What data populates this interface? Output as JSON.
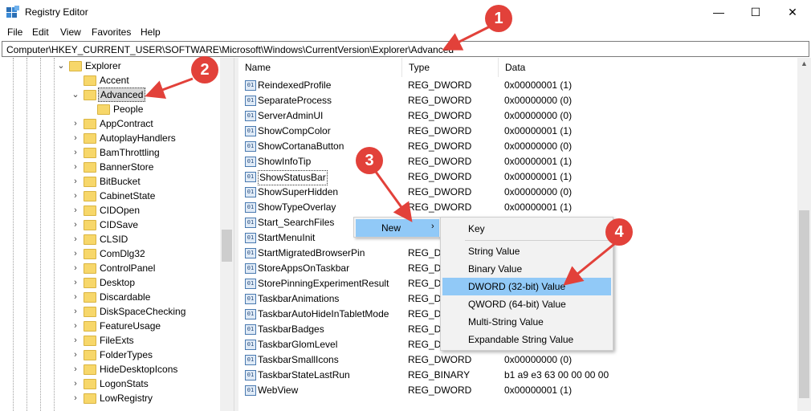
{
  "window": {
    "title": "Registry Editor",
    "minimize_glyph": "—",
    "maximize_glyph": "☐",
    "close_glyph": "✕"
  },
  "menubar": {
    "items": [
      "File",
      "Edit",
      "View",
      "Favorites",
      "Help"
    ]
  },
  "address": {
    "path": "Computer\\HKEY_CURRENT_USER\\SOFTWARE\\Microsoft\\Windows\\CurrentVersion\\Explorer\\Advanced"
  },
  "tree": {
    "items": [
      {
        "label": "Explorer",
        "expanded": true,
        "selected": false
      },
      {
        "label": "Accent",
        "expanded": false,
        "selected": false
      },
      {
        "label": "Advanced",
        "expanded": true,
        "selected": true
      },
      {
        "label": "People",
        "expanded": false,
        "selected": false
      },
      {
        "label": "AppContract",
        "expanded": false,
        "selected": false
      },
      {
        "label": "AutoplayHandlers",
        "expanded": false,
        "selected": false
      },
      {
        "label": "BamThrottling",
        "expanded": false,
        "selected": false
      },
      {
        "label": "BannerStore",
        "expanded": false,
        "selected": false
      },
      {
        "label": "BitBucket",
        "expanded": false,
        "selected": false
      },
      {
        "label": "CabinetState",
        "expanded": false,
        "selected": false
      },
      {
        "label": "CIDOpen",
        "expanded": false,
        "selected": false
      },
      {
        "label": "CIDSave",
        "expanded": false,
        "selected": false
      },
      {
        "label": "CLSID",
        "expanded": false,
        "selected": false
      },
      {
        "label": "ComDlg32",
        "expanded": false,
        "selected": false
      },
      {
        "label": "ControlPanel",
        "expanded": false,
        "selected": false
      },
      {
        "label": "Desktop",
        "expanded": false,
        "selected": false
      },
      {
        "label": "Discardable",
        "expanded": false,
        "selected": false
      },
      {
        "label": "DiskSpaceChecking",
        "expanded": false,
        "selected": false
      },
      {
        "label": "FeatureUsage",
        "expanded": false,
        "selected": false
      },
      {
        "label": "FileExts",
        "expanded": false,
        "selected": false
      },
      {
        "label": "FolderTypes",
        "expanded": false,
        "selected": false
      },
      {
        "label": "HideDesktopIcons",
        "expanded": false,
        "selected": false
      },
      {
        "label": "LogonStats",
        "expanded": false,
        "selected": false
      },
      {
        "label": "LowRegistry",
        "expanded": false,
        "selected": false
      }
    ]
  },
  "list": {
    "columns": {
      "name": "Name",
      "type": "Type",
      "data": "Data"
    },
    "rows": [
      {
        "name": "ReindexedProfile",
        "type": "REG_DWORD",
        "data": "0x00000001 (1)",
        "icon": "dword"
      },
      {
        "name": "SeparateProcess",
        "type": "REG_DWORD",
        "data": "0x00000000 (0)",
        "icon": "dword"
      },
      {
        "name": "ServerAdminUI",
        "type": "REG_DWORD",
        "data": "0x00000000 (0)",
        "icon": "dword"
      },
      {
        "name": "ShowCompColor",
        "type": "REG_DWORD",
        "data": "0x00000001 (1)",
        "icon": "dword"
      },
      {
        "name": "ShowCortanaButton",
        "type": "REG_DWORD",
        "data": "0x00000000 (0)",
        "icon": "dword"
      },
      {
        "name": "ShowInfoTip",
        "type": "REG_DWORD",
        "data": "0x00000001 (1)",
        "icon": "dword"
      },
      {
        "name": "ShowStatusBar",
        "type": "REG_DWORD",
        "data": "0x00000001 (1)",
        "icon": "dword",
        "focused": true
      },
      {
        "name": "ShowSuperHidden",
        "type": "REG_DWORD",
        "data": "0x00000000 (0)",
        "icon": "dword"
      },
      {
        "name": "ShowTypeOverlay",
        "type": "REG_DWORD",
        "data": "0x00000001 (1)",
        "icon": "dword"
      },
      {
        "name": "Start_SearchFiles",
        "type": "",
        "data": "",
        "icon": "dword"
      },
      {
        "name": "StartMenuInit",
        "type": "",
        "data": "",
        "icon": "dword"
      },
      {
        "name": "StartMigratedBrowserPin",
        "type": "REG_DW",
        "data": "",
        "icon": "dword"
      },
      {
        "name": "StoreAppsOnTaskbar",
        "type": "REG_DW",
        "data": "",
        "icon": "dword"
      },
      {
        "name": "StorePinningExperimentResult",
        "type": "REG_DW",
        "data": "",
        "icon": "dword"
      },
      {
        "name": "TaskbarAnimations",
        "type": "REG_DW",
        "data": "",
        "icon": "dword"
      },
      {
        "name": "TaskbarAutoHideInTabletMode",
        "type": "REG_DW",
        "data": "",
        "icon": "dword"
      },
      {
        "name": "TaskbarBadges",
        "type": "REG_DW",
        "data": "",
        "icon": "dword"
      },
      {
        "name": "TaskbarGlomLevel",
        "type": "REG_DW",
        "data": "",
        "icon": "dword"
      },
      {
        "name": "TaskbarSmallIcons",
        "type": "REG_DWORD",
        "data": "0x00000000 (0)",
        "icon": "dword"
      },
      {
        "name": "TaskbarStateLastRun",
        "type": "REG_BINARY",
        "data": "b1 a9 e3 63 00 00 00 00",
        "icon": "binary"
      },
      {
        "name": "WebView",
        "type": "REG_DWORD",
        "data": "0x00000001 (1)",
        "icon": "dword"
      }
    ]
  },
  "context_menu": {
    "new_label": "New",
    "new_arrow": "›"
  },
  "submenu": {
    "items": [
      "Key",
      "String Value",
      "Binary Value",
      "DWORD (32-bit) Value",
      "QWORD (64-bit) Value",
      "Multi-String Value",
      "Expandable String Value"
    ],
    "highlighted_index": 3
  },
  "annotations": {
    "labels": [
      "1",
      "2",
      "3",
      "4"
    ],
    "color": "#e2413a"
  },
  "colors": {
    "menu_highlight": "#91c9f7",
    "tree_selected_bg": "#d9d9d9"
  }
}
